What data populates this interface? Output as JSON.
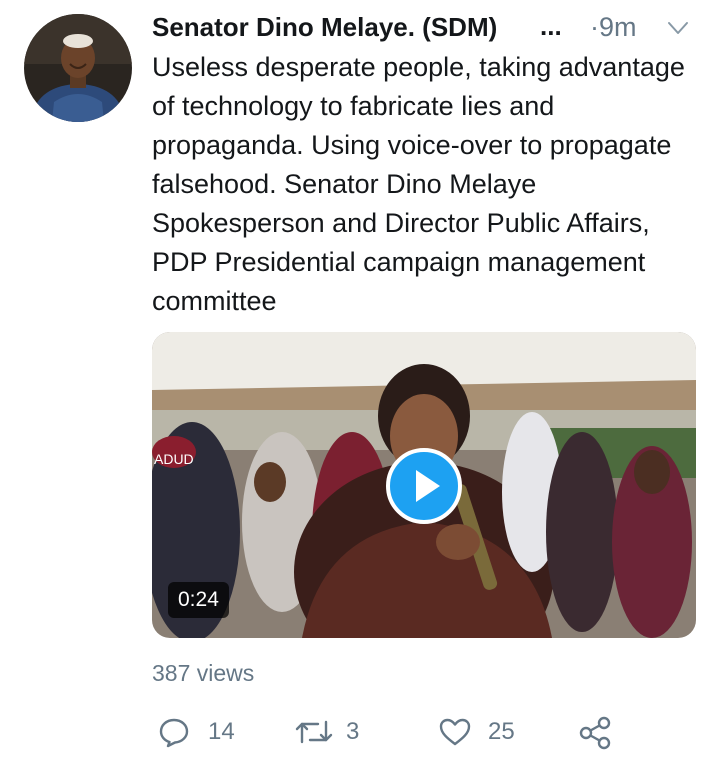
{
  "tweet": {
    "author_name": "Senator Dino Melaye. (SDM)",
    "ellipsis": "...",
    "time": "·9m",
    "text": "Useless desperate people, taking advantage of technology to fabricate lies and propaganda. Using voice-over to propagate falsehood. Senator Dino Melaye Spokesperson and Director Public Affairs, PDP Presidential campaign management committee",
    "video": {
      "duration": "0:24",
      "banner_fragment": "ADUD"
    },
    "views": "387 views",
    "actions": {
      "reply_count": "14",
      "retweet_count": "3",
      "like_count": "25"
    }
  },
  "icons": {
    "more": "chevron-down-icon",
    "play": "play-icon",
    "reply": "reply-icon",
    "retweet": "retweet-icon",
    "like": "heart-icon",
    "share": "share-icon"
  },
  "colors": {
    "accent": "#1da1f2",
    "text_primary": "#14171a",
    "text_secondary": "#657786"
  }
}
